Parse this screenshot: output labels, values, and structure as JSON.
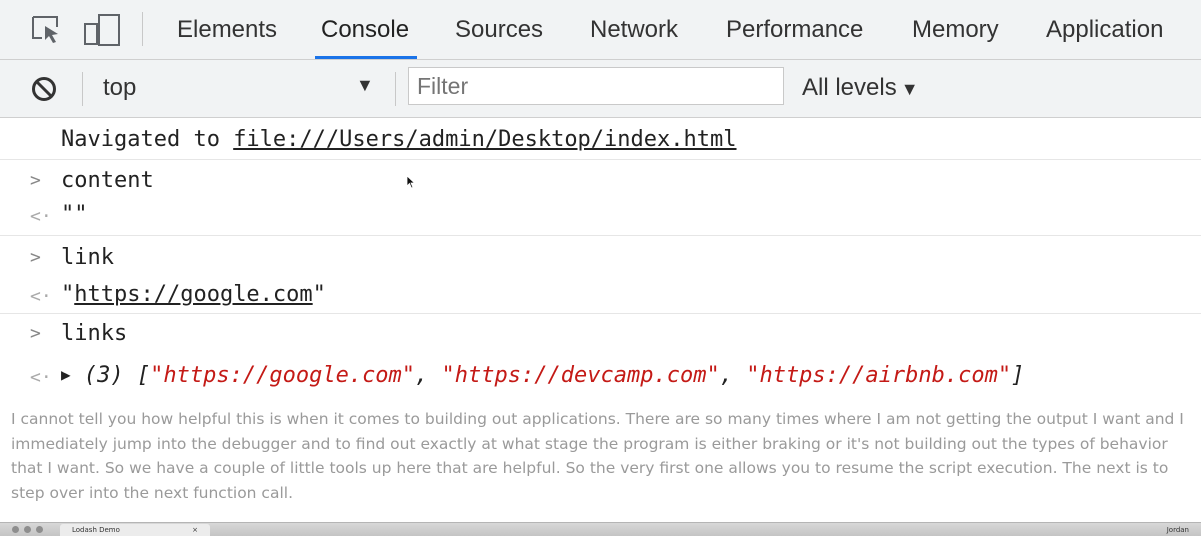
{
  "devtools": {
    "tabs": [
      "Elements",
      "Console",
      "Sources",
      "Network",
      "Performance",
      "Memory",
      "Application"
    ],
    "active_tab": "Console",
    "toolbar": {
      "context": "top",
      "filter_placeholder": "Filter",
      "levels": "All levels"
    }
  },
  "console": {
    "navigated_prefix": "Navigated to ",
    "navigated_url": "file:///Users/admin/Desktop/index.html",
    "entries": [
      {
        "input": "content",
        "output": "\"\""
      },
      {
        "input": "link",
        "output_quote_open": "\"",
        "output_link": "https://google.com",
        "output_quote_close": "\""
      },
      {
        "input": "links",
        "array_count": "(3)",
        "array_open": "[",
        "array_items": [
          "\"https://google.com\"",
          "\"https://devcamp.com\"",
          "\"https://airbnb.com\""
        ],
        "array_sep": ", ",
        "array_close": "]"
      }
    ]
  },
  "caption": "I cannot tell you how helpful this is when it comes to building out applications. There are so many times where I am not getting the output I want and I immediately jump into the debugger and to find out exactly at what stage the program is either braking or it's not building out the types of behavior that I want. So we have a couple of little tools up here that are helpful. So the very first one allows you to resume the script execution. The next is to step over into the next function call.",
  "browser_strip": {
    "tab_title": "Lodash Demo",
    "tab_close": "×",
    "user": "Jordan"
  },
  "colors": {
    "active_tab_underline": "#1a73e8",
    "string_red": "#c41a16",
    "toolbar_bg": "#f1f3f4",
    "caption_gray": "#9a9a9a"
  },
  "icons": [
    "inspect-element-icon",
    "device-toolbar-icon",
    "clear-console-icon",
    "context-dropdown-icon",
    "levels-dropdown-icon",
    "input-prompt-icon",
    "result-arrow-icon",
    "expand-triangle-icon",
    "mouse-cursor-icon"
  ]
}
